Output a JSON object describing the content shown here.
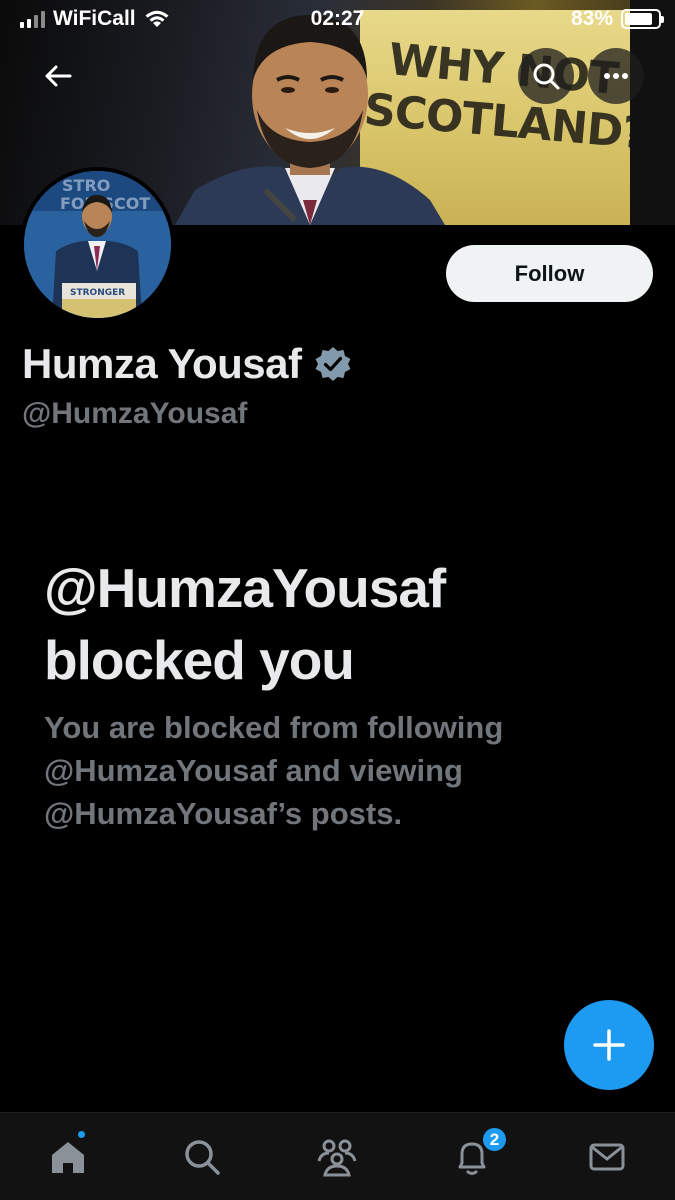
{
  "status_bar": {
    "carrier": "WiFiCall",
    "time": "02:27",
    "battery_percent": "83%",
    "battery_level": 0.83
  },
  "banner": {
    "sign_text": "WHY NOT SCOTLAND?"
  },
  "avatar": {
    "podium_text": "STRONGER"
  },
  "profile": {
    "name": "Humza Yousaf",
    "handle": "@HumzaYousaf",
    "verified_icon": "verified-badge-icon",
    "follow_label": "Follow"
  },
  "blocked": {
    "title_line1": "@HumzaYousaf",
    "title_line2": "blocked you",
    "description": "You are blocked from following @HumzaYousaf and viewing @HumzaYousaf’s posts."
  },
  "tab_bar": {
    "items": [
      "home-icon",
      "search-icon",
      "communities-icon",
      "notifications-icon",
      "messages-icon"
    ],
    "notification_count": "2"
  },
  "colors": {
    "accent": "#1d9bf0",
    "background": "#000000",
    "secondary_text": "#71767b",
    "verified": "#829aab"
  }
}
